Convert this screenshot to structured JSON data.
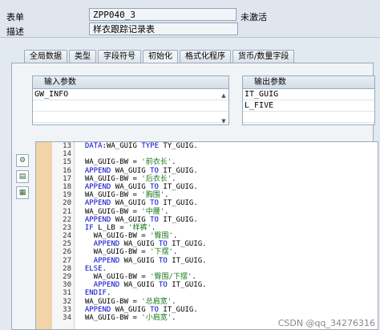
{
  "header": {
    "table_label": "表单",
    "table_value": "ZPP040_3",
    "status": "未激活",
    "desc_label": "描述",
    "desc_value": "样衣跟踪记录表"
  },
  "tabs": [
    {
      "label": "全局数据"
    },
    {
      "label": "类型"
    },
    {
      "label": "字段符号"
    },
    {
      "label": "初始化",
      "active": true
    },
    {
      "label": "格式化程序"
    },
    {
      "label": "货币/数量字段"
    }
  ],
  "input_params": {
    "title": "输入参数",
    "rows": [
      "GW_INFO",
      "",
      ""
    ]
  },
  "output_params": {
    "title": "输出参数",
    "rows": [
      "IT_GUIG",
      "L_FIVE",
      ""
    ]
  },
  "editor": {
    "line_numbers": [
      "13",
      "14",
      "15",
      "16",
      "17",
      "18",
      "19",
      "20",
      "21",
      "22",
      "23",
      "24",
      "25",
      "26",
      "27",
      "28",
      "29",
      "30",
      "31",
      "32",
      "33",
      "34"
    ],
    "lines": [
      "  DATA:WA_GUIG TYPE TY_GUIG.",
      "",
      "  WA_GUIG-BW = '前衣长'.",
      "  APPEND WA_GUIG TO IT_GUIG.",
      "  WA_GUIG-BW = '后衣长'.",
      "  APPEND WA_GUIG TO IT_GUIG.",
      "  WA_GUIG-BW = '胸围'.",
      "  APPEND WA_GUIG TO IT_GUIG.",
      "  WA_GUIG-BW = '中腰'.",
      "  APPEND WA_GUIG TO IT_GUIG.",
      "  IF L_LB = '样裤'.",
      "    WA_GUIG-BW = '臀围'.",
      "    APPEND WA_GUIG TO IT_GUIG.",
      "    WA_GUIG-BW = '下摆'.",
      "    APPEND WA_GUIG TO IT_GUIG.",
      "  ELSE.",
      "    WA_GUIG-BW = '臀围/下摆'.",
      "    APPEND WA_GUIG TO IT_GUIG.",
      "  ENDIF.",
      "  WA_GUIG-BW = '总肩宽'.",
      "  APPEND WA_GUIG TO IT_GUIG.",
      "  WA_GUIG-BW = '小肩宽'."
    ]
  },
  "watermark": "CSDN @qq_34276316"
}
